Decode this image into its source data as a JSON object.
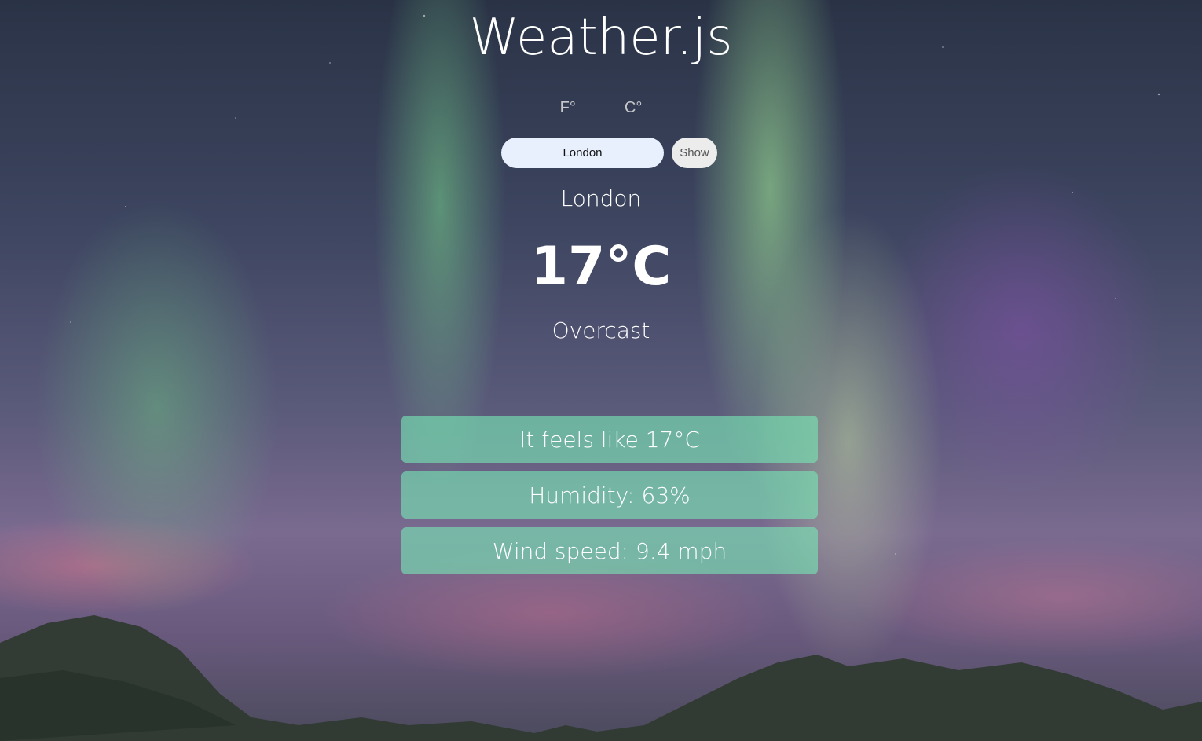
{
  "app": {
    "title": "Weather.js"
  },
  "units": {
    "fahrenheit_label": "F°",
    "celsius_label": "C°"
  },
  "search": {
    "value": "London",
    "button_label": "Show"
  },
  "weather": {
    "city": "London",
    "temperature": "17°C",
    "condition": "Overcast"
  },
  "details": {
    "feels_like": "It feels like 17°C",
    "humidity": "Humidity: 63%",
    "wind_speed": "Wind speed: 9.4 mph"
  },
  "colors": {
    "card_background": "#78e6b4",
    "input_background": "#e8f0fe",
    "button_background": "#ececec"
  },
  "background": {
    "description_icon": "aurora-background"
  }
}
